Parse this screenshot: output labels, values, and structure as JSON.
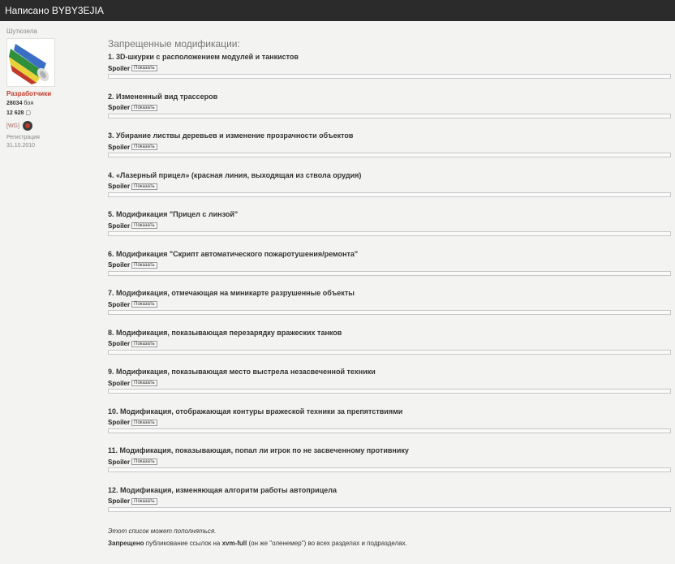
{
  "header": {
    "title": "Написано BYBY3EJIA"
  },
  "profile": {
    "rank": "Шутюзела",
    "avatar_icon": "vuvuzela-avatar",
    "group": "Разработчики",
    "battles_value": "28034",
    "battles_label": "боя",
    "posts_value": "12 628",
    "clan_tag": "[WG]",
    "clan_icon": "wg-clan-icon",
    "registration_label": "Регистрация",
    "registration_date": "31.10.2010"
  },
  "post": {
    "heading": "Запрещенные модификации:",
    "spoiler_label": "Spoiler",
    "show_button": "Показать",
    "items": [
      "1. 3D-шкурки с расположением модулей и танкистов",
      "2. Измененный вид трассеров",
      "3. Убирание листвы деревьев и изменение прозрачности объектов",
      "4. «Лазерный прицел» (красная линия, выходящая из ствола орудия)",
      "5. Модификация \"Прицел с линзой\"",
      "6. Модификация \"Скрипт автоматического пожаротушения/ремонта\"",
      "7. Модификация, отмечающая на миникарте разрушенные объекты",
      "8. Модификация, показывающая перезарядку вражеских танков",
      "9. Модификация, показывающая место выстрела незасвеченной техники",
      "10. Модификация, отображающая контуры вражеской техники за препятствиями",
      "11. Модификация, показывающая, попал ли игрок по не засвеченному противнику",
      "12. Модификация, изменяющая алгоритм работы автоприцела"
    ],
    "note": "Этот список может пополняться.",
    "forbidden_bold": "Запрещено",
    "forbidden_text_1": "публикование ссылок на",
    "forbidden_link": "xvm-full",
    "forbidden_text_2": "(он же \"оленемер\") во всех разделах и подразделах."
  }
}
